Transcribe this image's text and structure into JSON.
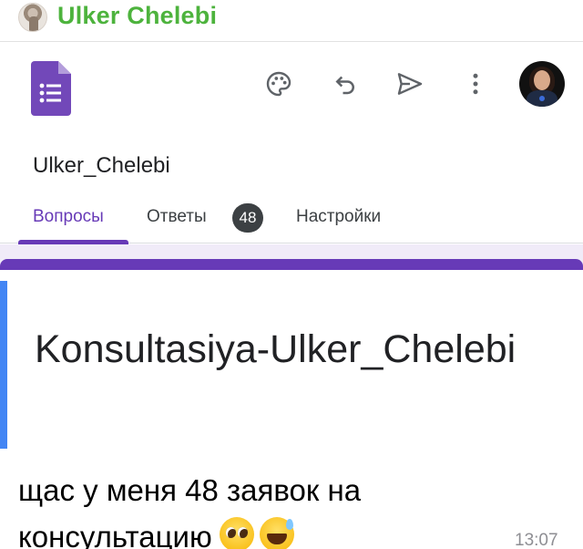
{
  "chat": {
    "sender_name": "Ulker Chelebi"
  },
  "forms": {
    "form_name": "Ulker_Chelebi",
    "tabs": [
      {
        "label": "Вопросы",
        "active": true
      },
      {
        "label": "Ответы",
        "badge": "48"
      },
      {
        "label": "Настройки"
      }
    ],
    "form_title": "Konsultasiya-Ulker_Chelebi",
    "toolbar_icons": [
      "palette-icon",
      "undo-icon",
      "send-icon",
      "more-vert-icon"
    ],
    "colors": {
      "accent": "#673ab7",
      "focus_bar": "#4285f4",
      "canvas": "#f0ebf8"
    }
  },
  "message": {
    "text": "щас у меня 48 заявок на консультацию",
    "emojis": [
      "pleading-face",
      "grinning-sweat-face"
    ],
    "time": "13:07"
  },
  "colors": {
    "sender_name": "#4db33d"
  }
}
